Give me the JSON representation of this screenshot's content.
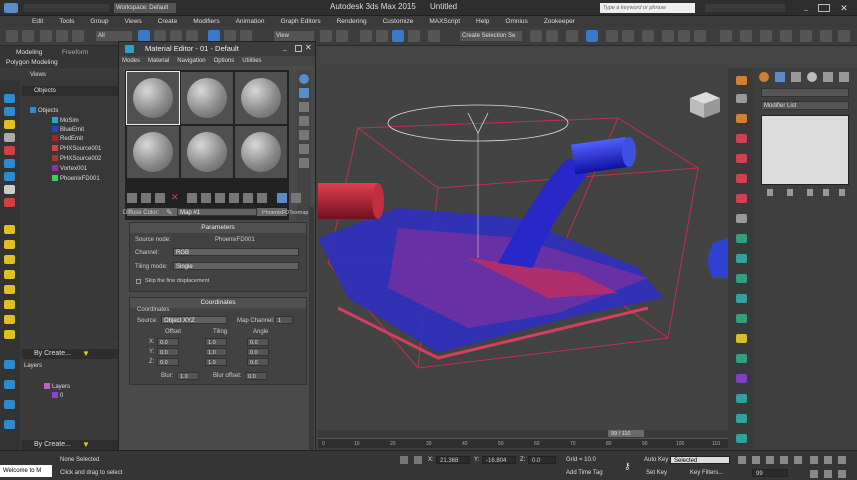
{
  "app": {
    "title": "Autodesk 3ds Max  2015",
    "doc": "Untitled",
    "workspace": "Workspace: Default",
    "search_placeholder": "Type a keyword or phrase"
  },
  "menu": [
    "Edit",
    "Tools",
    "Group",
    "Views",
    "Create",
    "Modifiers",
    "Animation",
    "Graph Editors",
    "Rendering",
    "Customize",
    "MAXScript",
    "Help",
    "Omnius",
    "Zookeeper"
  ],
  "toolbar": {
    "selection_filter": "All",
    "ref_coord": "View",
    "named_selection": "Create Selection Se"
  },
  "ribbon": {
    "tab_modeling": "Modeling",
    "tab_freeform": "Freeform",
    "sub": "Polygon Modeling"
  },
  "explorer": {
    "tab_views": "Views",
    "header": "Objects",
    "root": "Objects",
    "items": [
      {
        "name": "MoSim",
        "color": "#22aacc"
      },
      {
        "name": "BlueEmit",
        "color": "#2244cc"
      },
      {
        "name": "RedEmit",
        "color": "#aa2222"
      },
      {
        "name": "PHXSource001",
        "color": "#cc4444"
      },
      {
        "name": "PHXSource002",
        "color": "#aa3333"
      },
      {
        "name": "Vortex001",
        "color": "#8833aa"
      },
      {
        "name": "PhoenixFD001",
        "color": "#44cc55"
      }
    ],
    "by_create_1": "By Create...",
    "layers_header": "Layers",
    "layer_items": [
      "Layers",
      "0"
    ],
    "by_create_2": "By Create..."
  },
  "mat": {
    "title": "Material Editor - 01 - Default",
    "menu": [
      "Modes",
      "Material",
      "Navigation",
      "Options",
      "Utilities"
    ],
    "diffuse_label": "Diffuse Color:",
    "map_name": "Map #1",
    "map_type": "PhoenixFDTexmap",
    "params_title": "Parameters",
    "source_label": "Source node:",
    "source_value": "PhoenixFD001",
    "channel_label": "Channel:",
    "channel_value": "RGB",
    "tiling_label": "Tiling mode:",
    "tiling_value": "Single",
    "skip_label": "Skip the fine displacement",
    "coords_title": "Coordinates",
    "coords_sub": "Coordinates",
    "source2_label": "Source:",
    "source2_value": "Object XYZ",
    "mapch_label": "Map Channel:",
    "mapch_value": "1",
    "offset": "Offset",
    "tiling": "Tiling",
    "angle": "Angle",
    "x": "X:",
    "y": "Y:",
    "z": "Z:",
    "offset_vals": [
      "0.0",
      "0.0",
      "0.0"
    ],
    "tiling_vals": [
      "1.0",
      "1.0",
      "1.0"
    ],
    "angle_vals": [
      "0.0",
      "0.0",
      "0.0"
    ],
    "blur_label": "Blur:",
    "blur_value": "1.0",
    "blur_off_label": "Blur offset:",
    "blur_off_value": "0.0"
  },
  "cmd": {
    "modifier_list": "Modifier List"
  },
  "timeline": {
    "frame": "99 / 110",
    "ticks": [
      "0",
      "10",
      "20",
      "30",
      "40",
      "50",
      "60",
      "70",
      "80",
      "90",
      "100",
      "110"
    ]
  },
  "status": {
    "script": "Welcome to M",
    "none_selected": "None Selected",
    "hint": "Click and drag to select",
    "x_label": "X:",
    "x_value": "21.368",
    "y_label": "Y:",
    "y_value": "-16.804",
    "z_label": "Z:",
    "z_value": "0.0",
    "grid": "Grid = 10.0",
    "add_time_tag": "Add Time Tag",
    "auto_key": "Auto Key",
    "selected": "Selected",
    "set_key": "Set Key",
    "key_filters": "Key Filters...",
    "frame": "99"
  }
}
